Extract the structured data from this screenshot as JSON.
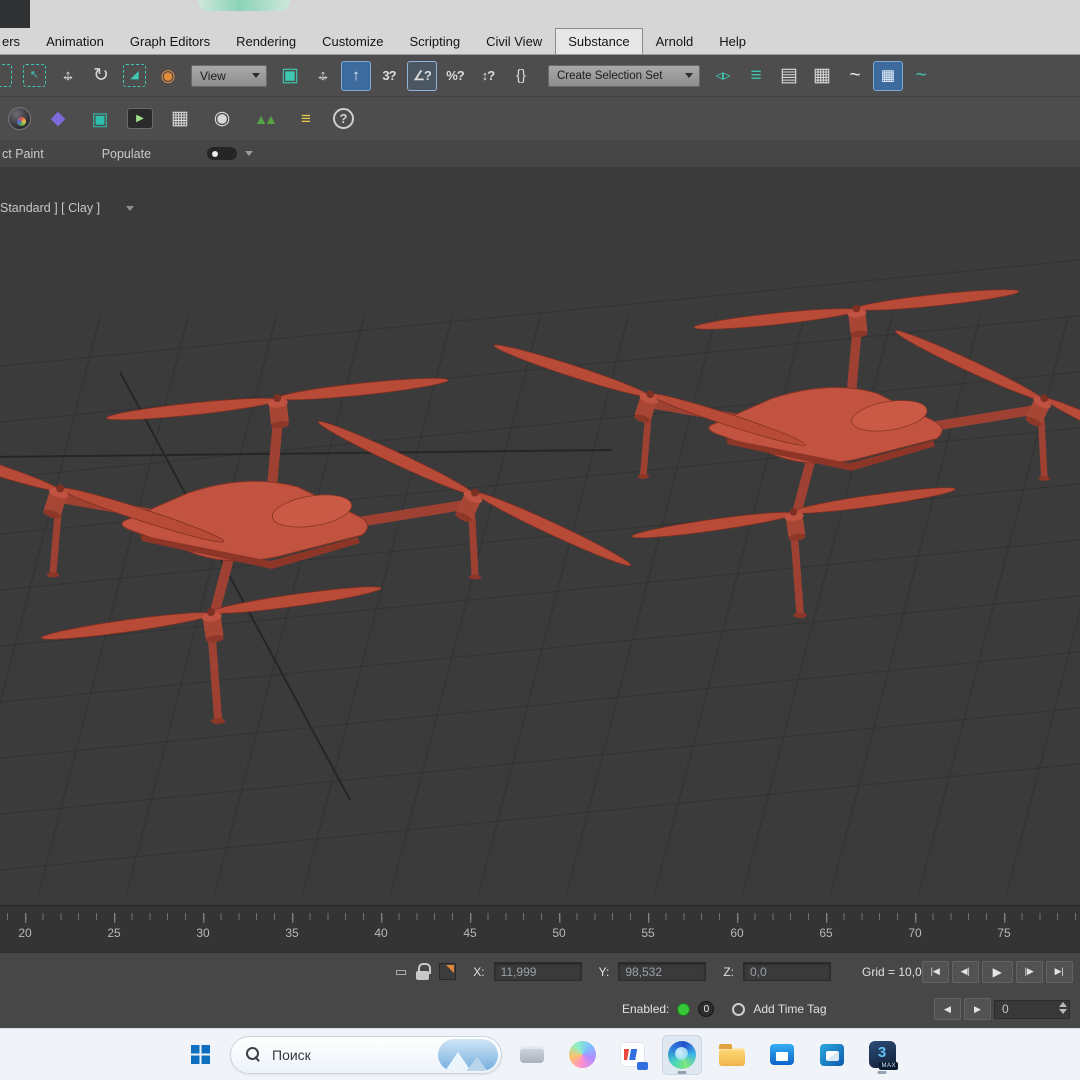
{
  "menubar": {
    "items": [
      "ers",
      "Animation",
      "Graph Editors",
      "Rendering",
      "Customize",
      "Scripting",
      "Civil View",
      "Substance",
      "Arnold",
      "Help"
    ],
    "active": "Substance"
  },
  "toolbar_main": {
    "view_dropdown_label": "View",
    "selection_set_label": "Create Selection Set",
    "icons_a": [
      {
        "name": "selection-region-cut-icon",
        "cls": "dash cut",
        "glyph": ""
      },
      {
        "name": "select-object-icon",
        "cls": "dash",
        "glyph": "↖"
      },
      {
        "name": "select-and-move-icon",
        "cls": "light",
        "glyph": "↔",
        "glyph2": "↕"
      },
      {
        "name": "select-and-rotate-icon",
        "cls": "light big",
        "glyph": "↻"
      },
      {
        "name": "select-and-scale-icon",
        "cls": "dash",
        "glyph": "◢"
      },
      {
        "name": "select-and-place-icon",
        "cls": "orange",
        "glyph": "◉"
      }
    ],
    "icons_b": [
      {
        "name": "use-pivot-point-icon",
        "cls": "teal big",
        "glyph": "▣"
      },
      {
        "name": "select-and-manipulate-icon",
        "cls": "light",
        "glyph": "↔",
        "glyph2": "↕"
      },
      {
        "name": "snaps-toggle-icon",
        "cls": "activebtn",
        "glyph": "↑"
      },
      {
        "name": "snaps-3d-icon",
        "cls": "snap",
        "glyph": "3?"
      },
      {
        "name": "angle-snap-icon",
        "cls": "snap bordered",
        "glyph": "∠?"
      },
      {
        "name": "percent-snap-icon",
        "cls": "snap",
        "glyph": "%?"
      },
      {
        "name": "spinner-snap-icon",
        "cls": "snap",
        "glyph": "↕?"
      },
      {
        "name": "named-selection-sets-icon",
        "cls": "light",
        "glyph": "{}"
      }
    ],
    "icons_c": [
      {
        "name": "mirror-icon",
        "cls": "teal",
        "glyph": "◃▹"
      },
      {
        "name": "align-icon",
        "cls": "teal big",
        "glyph": "≡"
      },
      {
        "name": "toggle-scene-explorer-icon",
        "cls": "light big",
        "glyph": "▤"
      },
      {
        "name": "toggle-layer-explorer-icon",
        "cls": "light big",
        "glyph": "▦"
      },
      {
        "name": "curve-editor-icon",
        "cls": "white big",
        "glyph": "~"
      },
      {
        "name": "schematic-view-icon",
        "cls": "activebtn",
        "glyph": "▦"
      },
      {
        "name": "material-editor-wave-icon",
        "cls": "teal big",
        "glyph": "~"
      }
    ]
  },
  "toolbar_render": {
    "icons": [
      {
        "name": "render-setup-icon",
        "cls": "ball",
        "glyph": ""
      },
      {
        "name": "compact-material-editor-icon",
        "cls": "purple",
        "glyph": "◆"
      },
      {
        "name": "rendered-frame-window-icon",
        "cls": "tealfill",
        "glyph": "▣"
      },
      {
        "name": "preview-window-icon",
        "cls": "screen",
        "glyph": "▶"
      },
      {
        "name": "grid-create-icon",
        "cls": "light big",
        "glyph": "▦"
      },
      {
        "name": "render-view-icon",
        "cls": "light big",
        "glyph": "◉"
      },
      {
        "name": "vegetation-icon",
        "cls": "trees",
        "glyph": "▲▲"
      },
      {
        "name": "listener-icon",
        "cls": "yellow",
        "glyph": "≡"
      },
      {
        "name": "help-icon",
        "cls": "circle",
        "glyph": "?"
      }
    ]
  },
  "ribbon": {
    "object_paint_label": "ct Paint",
    "populate_label": "Populate"
  },
  "viewport": {
    "shading_label": "Standard ] [ Clay ]"
  },
  "timeline": {
    "labels": [
      "20",
      "25",
      "30",
      "35",
      "40",
      "45",
      "50",
      "55",
      "60",
      "65",
      "70",
      "75"
    ]
  },
  "status_bar": {
    "x_label": "X:",
    "x_value": "11,999",
    "y_label": "Y:",
    "y_value": "98,532",
    "z_label": "Z:",
    "z_value": "0,0",
    "grid_label": "Grid = 10,0",
    "enabled_label": "Enabled:",
    "counter_value": "0",
    "add_time_tag_label": "Add Time Tag",
    "frame_spinner_value": "0",
    "transport_row1": [
      {
        "name": "go-to-start-button",
        "glyph": "|◀"
      },
      {
        "name": "previous-frame-button",
        "glyph": "◀|"
      },
      {
        "name": "play-animation-button",
        "glyph": "▶",
        "cls": "play"
      },
      {
        "name": "next-frame-button",
        "glyph": "|▶"
      },
      {
        "name": "go-to-end-button",
        "glyph": "▶|"
      }
    ],
    "transport_row2": [
      {
        "name": "previous-key-button",
        "glyph": "◀"
      },
      {
        "name": "next-key-button",
        "glyph": "▶"
      }
    ]
  },
  "taskbar": {
    "search_label": "Поиск",
    "apps": [
      {
        "name": "widgets-device"
      },
      {
        "name": "copilot"
      },
      {
        "name": "chat-app",
        "badge": true
      },
      {
        "name": "edge",
        "active": true,
        "focused": true
      },
      {
        "name": "file-explorer-folder"
      },
      {
        "name": "microsoft-store"
      },
      {
        "name": "outlook"
      },
      {
        "name": "3ds-max",
        "active": true,
        "label": "3",
        "badge_label": "MAX"
      }
    ]
  },
  "colors": {
    "drone_body": "#c25340",
    "drone_dark": "#9e4132",
    "viewport_bg": "#3b3b3b",
    "accent_blue": "#3d6b9d",
    "taskbar_bg": "#f0f4f9"
  }
}
